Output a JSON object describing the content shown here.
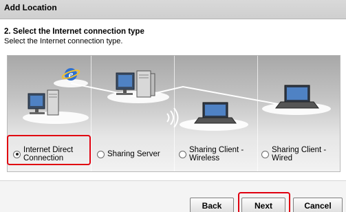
{
  "window": {
    "title": "Add Location"
  },
  "step": {
    "heading": "2. Select the Internet connection type",
    "description": "Select the Internet connection type."
  },
  "options": [
    {
      "label": "Internet Direct\nConnection",
      "selected": true
    },
    {
      "label": "Sharing Server",
      "selected": false
    },
    {
      "label": "Sharing Client -\nWireless",
      "selected": false
    },
    {
      "label": "Sharing Client -\nWired",
      "selected": false
    }
  ],
  "buttons": {
    "back": "Back",
    "next": "Next",
    "cancel": "Cancel"
  },
  "colors": {
    "highlight": "#e0000f",
    "panel_top": "#a8a8a8",
    "panel_bottom": "#f2f2f2"
  },
  "icons": [
    "internet-explorer-icon",
    "desktop-computer-icon",
    "server-computer-icon",
    "wireless-signal-icon",
    "laptop-icon"
  ]
}
